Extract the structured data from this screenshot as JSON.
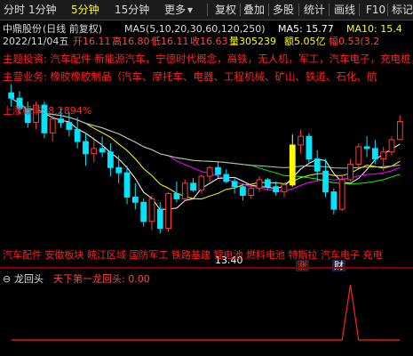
{
  "toolbar": {
    "tabs": [
      "分时",
      "1分钟",
      "5分钟",
      "15分钟",
      "更多"
    ],
    "right_tabs": [
      "复权",
      "叠加",
      "多股",
      "统计",
      "画线",
      "F10",
      "标记"
    ],
    "selected_tab": "5分钟"
  },
  "header": {
    "stock": "中鼎股份",
    "mode": "(日线 前复权)",
    "ma_params": "MA5(5,10,20,30,60,120,250)",
    "ma5_label": "MA5: 15.77",
    "ma10_label": "MA10: 15.4",
    "date": "2022/11/04五",
    "open": "开16.11",
    "high": "高16.80",
    "low": "低16.11",
    "close": "收16.63",
    "volume": "量305239",
    "amount": "额5.05亿",
    "change": "幅0.53(3.2"
  },
  "overlay": {
    "line1": "主题投资: 汽车配件 新能源汽车，宁德时代概念，高铁，无人机，军工，汽车电子，充电桩，",
    "line2": "主营业务: 橡胶橡胶制品（汽车、摩托车、电器、工程机械、矿山、铁道、石化、航",
    "percent_label": "上涨概率: 8.2894%",
    "low_price": "13.40",
    "concepts_row": "汽车配件 安徽板块 皖江区域 国防军工 铁路基建 锂电池 燃料电池 特斯拉 汽车电子 充电",
    "badge_zhang": "涨",
    "badge_cai": "财"
  },
  "indicator": {
    "name": "龙回头",
    "title": "天下第一龙回头: 0.00"
  },
  "colors": {
    "up": "#ff3b3b",
    "down": "#00e5ff",
    "ma5": "#ffffff",
    "ma10": "#ffff00",
    "ma20": "#ff00ff",
    "ma30": "#00ff00",
    "ma60": "#c0c0c0",
    "highlight": "#ffff00",
    "toolbar_text": "#dddddd"
  },
  "chart_data": {
    "type": "candlestick",
    "ohlc": [
      [
        17.45,
        17.7,
        17.05,
        17.3
      ],
      [
        17.3,
        17.5,
        16.85,
        17.0
      ],
      [
        17.0,
        17.2,
        16.45,
        16.6
      ],
      [
        16.6,
        17.2,
        16.4,
        17.1
      ],
      [
        17.1,
        17.2,
        16.15,
        16.3
      ],
      [
        16.3,
        16.8,
        16.05,
        16.7
      ],
      [
        16.7,
        17.0,
        16.45,
        16.6
      ],
      [
        16.6,
        16.9,
        16.2,
        16.4
      ],
      [
        16.4,
        16.75,
        15.85,
        16.05
      ],
      [
        16.05,
        16.3,
        15.35,
        15.7
      ],
      [
        15.7,
        16.1,
        15.45,
        15.85
      ],
      [
        15.85,
        16.2,
        15.6,
        15.75
      ],
      [
        15.75,
        16.0,
        15.05,
        15.3
      ],
      [
        15.3,
        15.65,
        14.85,
        15.15
      ],
      [
        15.15,
        15.35,
        14.25,
        14.45
      ],
      [
        14.45,
        14.85,
        14.1,
        14.3
      ],
      [
        14.3,
        14.4,
        13.6,
        13.75
      ],
      [
        13.75,
        14.5,
        13.5,
        14.4
      ],
      [
        14.1,
        14.3,
        13.4,
        13.55
      ],
      [
        13.55,
        14.6,
        13.45,
        14.55
      ],
      [
        14.55,
        14.9,
        14.3,
        14.4
      ],
      [
        14.4,
        14.95,
        14.35,
        14.85
      ],
      [
        14.85,
        15.0,
        14.6,
        14.65
      ],
      [
        14.65,
        15.1,
        14.55,
        15.05
      ],
      [
        15.05,
        15.35,
        14.9,
        15.3
      ],
      [
        15.3,
        15.45,
        15.0,
        15.1
      ],
      [
        15.1,
        15.25,
        14.85,
        14.9
      ],
      [
        14.9,
        15.0,
        14.55,
        14.75
      ],
      [
        14.75,
        14.85,
        14.35,
        14.5
      ],
      [
        14.5,
        14.8,
        14.4,
        14.7
      ],
      [
        14.7,
        15.05,
        14.6,
        14.95
      ],
      [
        14.95,
        15.0,
        14.65,
        14.75
      ],
      [
        14.75,
        14.9,
        14.5,
        14.6
      ],
      [
        14.6,
        14.85,
        14.45,
        14.8
      ],
      [
        14.8,
        16.25,
        14.75,
        15.95
      ],
      [
        15.95,
        16.4,
        15.7,
        16.2
      ],
      [
        16.2,
        16.3,
        15.4,
        15.55
      ],
      [
        15.55,
        15.8,
        14.9,
        15.2
      ],
      [
        15.2,
        15.55,
        14.45,
        14.6
      ],
      [
        14.6,
        14.7,
        13.95,
        14.1
      ],
      [
        14.1,
        15.1,
        14.05,
        14.95
      ],
      [
        14.95,
        15.55,
        14.9,
        15.4
      ],
      [
        15.4,
        16.0,
        15.3,
        15.9
      ],
      [
        15.9,
        16.2,
        15.6,
        15.85
      ],
      [
        15.85,
        16.1,
        15.4,
        15.55
      ],
      [
        15.55,
        15.9,
        15.2,
        15.75
      ],
      [
        15.75,
        16.2,
        15.65,
        16.1
      ],
      [
        16.11,
        16.8,
        16.11,
        16.63
      ]
    ],
    "ma_periods": [
      5,
      10,
      20,
      30,
      60
    ],
    "ylim": [
      13.0,
      18.0
    ],
    "highlight_bar_index": 34,
    "indicator": {
      "name": "龙回头",
      "values_nonzero_index": 41
    }
  }
}
